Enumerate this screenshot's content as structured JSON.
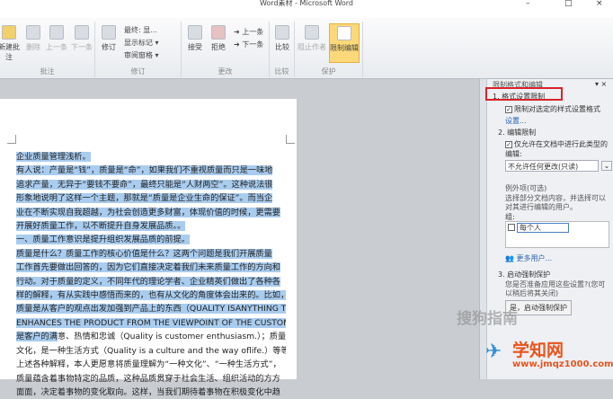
{
  "title": "Word素材 - Microsoft Word",
  "window_controls": [
    "–",
    "□",
    "×"
  ],
  "ribbon": {
    "groups": [
      {
        "label": "批注",
        "buttons": [
          "新建批注",
          "删除",
          "上一条",
          "下一条"
        ]
      },
      {
        "label": "修订",
        "buttons": [
          "修订"
        ],
        "small": [
          "最终: 显...",
          "显示标记 ▾",
          "审阅窗格 ▾"
        ]
      },
      {
        "label": "更改",
        "buttons": [
          "接受",
          "拒绝"
        ],
        "small": [
          "上一条",
          "下一条"
        ]
      },
      {
        "label": "比较",
        "buttons": [
          "比较"
        ]
      },
      {
        "label": "保护",
        "buttons": [
          "阻止作者",
          "限制编辑"
        ]
      }
    ]
  },
  "document": {
    "lines": [
      {
        "sel": "企业质量管理浅析。",
        "rest": ""
      },
      {
        "sel": "有人说：产量是“钱”，质量是“命”，如果我们不重视质量而只是一味地",
        "rest": ""
      },
      {
        "sel": "追求产量，无异于“要钱不要命”，最终只能是“人财两空”。这种说法很",
        "rest": ""
      },
      {
        "sel": "形象地说明了这样一个主题，那就是“质量是企业生命的保证”。而当企",
        "rest": ""
      },
      {
        "sel": "业在不断实现自我超越，为社会创造更多财富，体现价值的时候，更需要",
        "rest": ""
      },
      {
        "sel": "开展好质量工作，以不断提升自身发展品质。。",
        "rest": ""
      },
      {
        "sel": "一、质量工作意识是提升组织发展品质的前提。",
        "rest": ""
      },
      {
        "sel": "质量是什么？质量工作的核心价值是什么？这两个问题是我们开展质量",
        "rest": ""
      },
      {
        "sel": "工作首先要做出回答的，因为它们直接决定着我们未来质量工作的方向和",
        "rest": ""
      },
      {
        "sel": "行动。对于质量的定义，不同年代的理论学者、企业精英们做出了各种各",
        "rest": ""
      },
      {
        "sel": "样的解释，有从实践中感悟而来的，也有从文化的角度体会出来的。比如，",
        "rest": ""
      },
      {
        "sel": "质量是从客户的观点出发加强到产品上的东西（QUALITY ISANYTHING THAT",
        "rest": ""
      },
      {
        "sel": "ENHANCES THE PRODUCT FROM THE VIEWPOINT OF THE CUSTOMER.）；质量",
        "rest": ""
      },
      {
        "sel": "是客户的满",
        "rest": "意、热情和忠诚（Quality is customer enthusiasm.）；质量是一种"
      },
      {
        "sel": "",
        "rest": "文化，是一种生活方式（Quality is a culture and the way oflife.）等等。对于"
      },
      {
        "sel": "",
        "rest": "上述各种解释，本人更愿意将质量理解为“一种文化”、“一种生活方式”，"
      },
      {
        "sel": "",
        "rest": "质量蕴含着事物特定的品质，这种品质贯穿于社会生活、组织活动的方方"
      },
      {
        "sel": "",
        "rest": "面面，决定着事物的变化取向。这样，当我们期待着事物在积极变化中趋"
      }
    ]
  },
  "pane": {
    "title": "限制格式和编辑",
    "close": "▾ ×",
    "s1_title": "1. 格式设置限制",
    "s1_check": "限制对选定的样式设置格式",
    "s1_link": "设置...",
    "s2_title": "2. 编辑限制",
    "s2_check": "仅允许在文档中进行此类型的编辑:",
    "s2_select": "不允许任何更改(只读)",
    "exceptions_title": "例外项(可选)",
    "exceptions_desc": "选择部分文档内容，并选择可以对其进行编辑的用户。",
    "groups_label": "组:",
    "group_item": "每个人",
    "more_users": "更多用户...",
    "s3_title": "3. 启动强制保护",
    "s3_desc": "您是否准备应用这些设置?(您可以稍后将其关闭)",
    "s3_button": "是，启动强制保护"
  },
  "watermarks": {
    "sogou": "搜狗指南",
    "site_name": "学知网",
    "site_url": "www.jmqz1000.com"
  }
}
